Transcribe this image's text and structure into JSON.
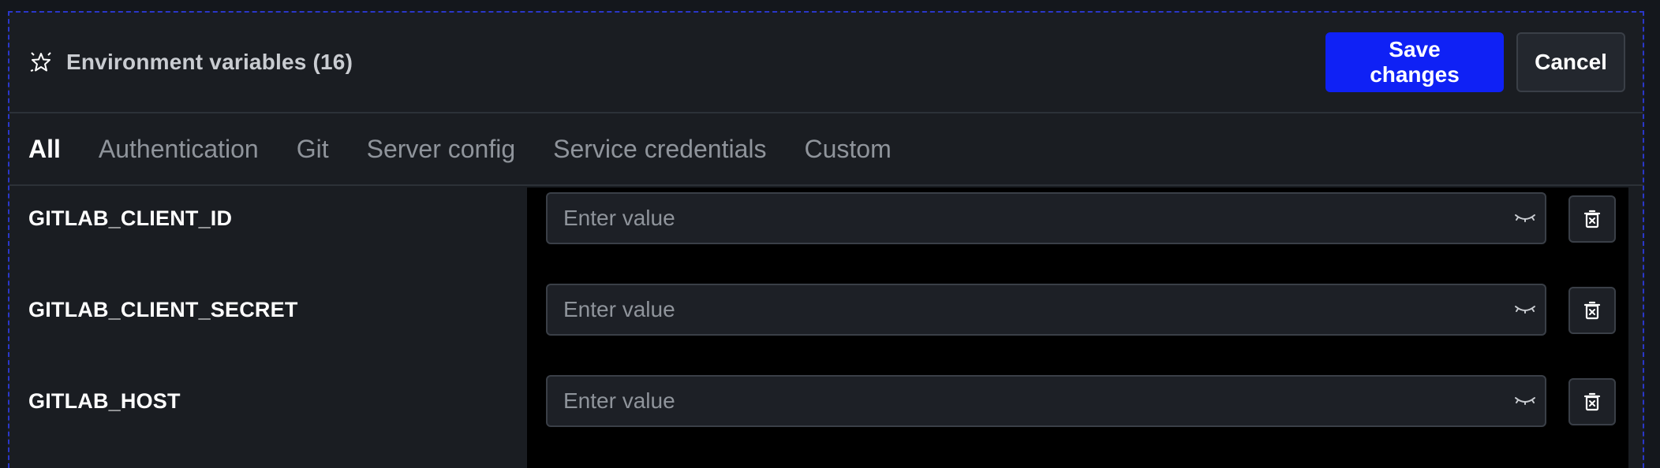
{
  "header": {
    "title": "Environment variables (16)",
    "icon": "sparkle-star-icon",
    "save_label": "Save changes",
    "cancel_label": "Cancel"
  },
  "tabs": [
    {
      "label": "All",
      "active": true
    },
    {
      "label": "Authentication",
      "active": false
    },
    {
      "label": "Git",
      "active": false
    },
    {
      "label": "Server config",
      "active": false
    },
    {
      "label": "Service credentials",
      "active": false
    },
    {
      "label": "Custom",
      "active": false
    }
  ],
  "variables": [
    {
      "key": "GITLAB_CLIENT_ID",
      "value": "",
      "placeholder": "Enter value"
    },
    {
      "key": "GITLAB_CLIENT_SECRET",
      "value": "",
      "placeholder": "Enter value"
    },
    {
      "key": "GITLAB_HOST",
      "value": "",
      "placeholder": "Enter value"
    }
  ],
  "icons": {
    "visibility": "eye-closed-icon",
    "delete": "trash-icon"
  },
  "colors": {
    "primary": "#0f21f5",
    "background": "#1a1d22",
    "panel": "#000000",
    "border": "#3a3f47"
  }
}
